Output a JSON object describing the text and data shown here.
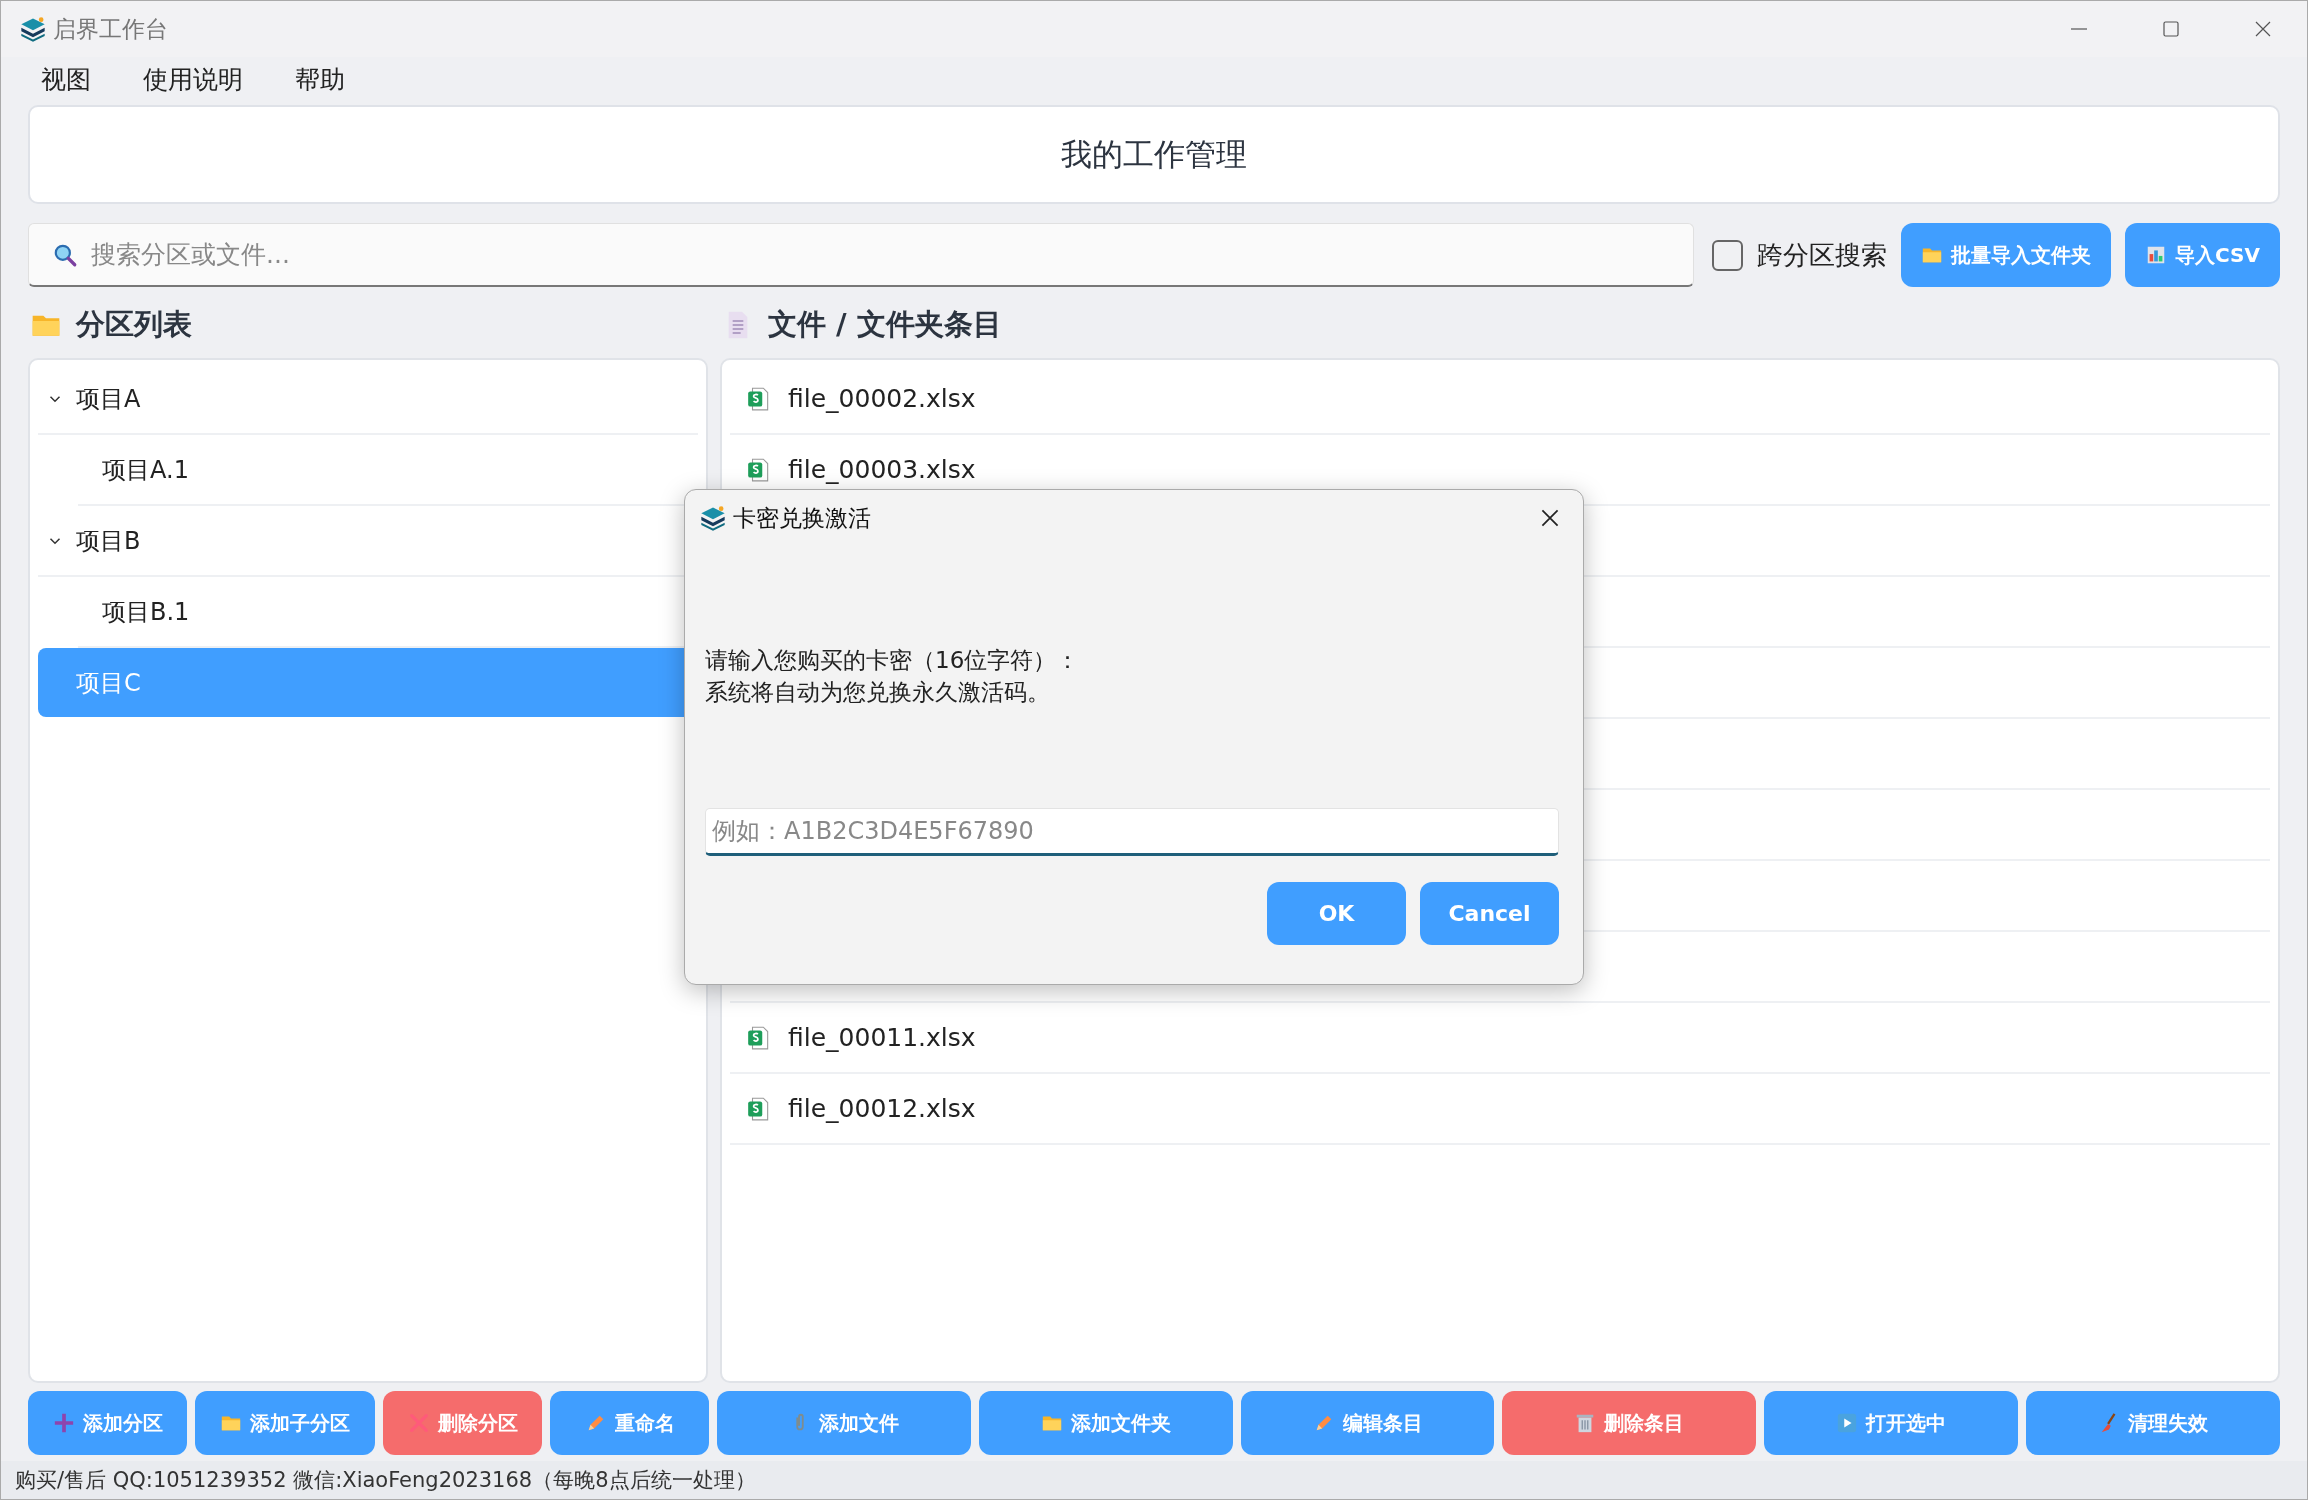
{
  "window": {
    "title": "启界工作台"
  },
  "menu": [
    "视图",
    "使用说明",
    "帮助"
  ],
  "header": {
    "title": "我的工作管理"
  },
  "search": {
    "placeholder": "搜索分区或文件..."
  },
  "cross_search": {
    "label": "跨分区搜索",
    "checked": false
  },
  "top_buttons": [
    {
      "label": "批量导入文件夹"
    },
    {
      "label": "导入CSV"
    }
  ],
  "partitions": {
    "title": "分区列表",
    "items": [
      {
        "label": "项目A",
        "expanded": true,
        "selected": false,
        "children": [
          {
            "label": "项目A.1",
            "selected": false
          }
        ]
      },
      {
        "label": "项目B",
        "expanded": true,
        "selected": false,
        "children": [
          {
            "label": "项目B.1",
            "selected": false
          }
        ]
      },
      {
        "label": "项目C",
        "selected": true
      }
    ]
  },
  "files": {
    "title": "文件 / 文件夹条目",
    "items": [
      {
        "name": "file_00002.xlsx"
      },
      {
        "name": "file_00003.xlsx"
      },
      {
        "name": "file_00011.xlsx"
      },
      {
        "name": "file_00012.xlsx"
      }
    ]
  },
  "bottom_buttons": [
    {
      "label": "添加分区",
      "kind": "primary"
    },
    {
      "label": "添加子分区",
      "kind": "primary"
    },
    {
      "label": "删除分区",
      "kind": "danger"
    },
    {
      "label": "重命名",
      "kind": "primary"
    },
    {
      "label": "添加文件",
      "kind": "primary"
    },
    {
      "label": "添加文件夹",
      "kind": "primary"
    },
    {
      "label": "编辑条目",
      "kind": "primary"
    },
    {
      "label": "删除条目",
      "kind": "danger"
    },
    {
      "label": "打开选中",
      "kind": "primary"
    },
    {
      "label": "清理失效",
      "kind": "primary"
    }
  ],
  "status_bar": "购买/售后 QQ:1051239352 微信:XiaoFeng2023168（每晚8点后统一处理）",
  "dialog": {
    "title": "卡密兑换激活",
    "message": [
      "请输入您购买的卡密（16位字符）：",
      "系统将自动为您兑换永久激活码。"
    ],
    "placeholder": "例如：A1B2C3D4E5F67890",
    "buttons": [
      "OK",
      "Cancel"
    ]
  }
}
